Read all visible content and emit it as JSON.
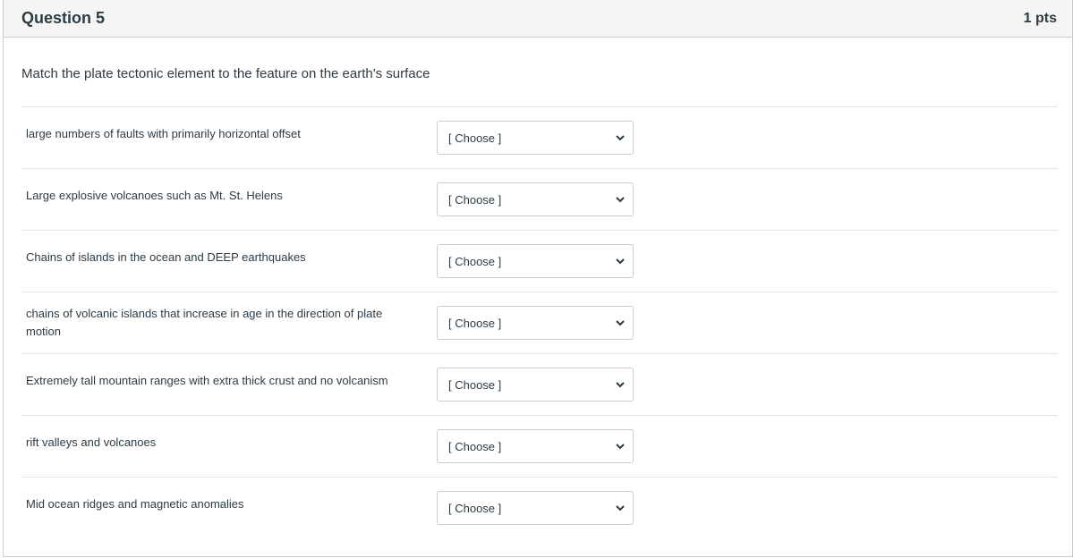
{
  "question": {
    "title": "Question 5",
    "points": "1 pts",
    "prompt": "Match the plate tectonic element to the feature on the earth's surface"
  },
  "rows": [
    {
      "label": "large numbers of faults with primarily horizontal offset",
      "selected": "[ Choose ]"
    },
    {
      "label": "Large explosive volcanoes such as Mt. St. Helens",
      "selected": "[ Choose ]"
    },
    {
      "label": "Chains of islands in the ocean and DEEP earthquakes",
      "selected": "[ Choose ]"
    },
    {
      "label": "chains of volcanic islands that increase in age in the direction of plate motion",
      "selected": "[ Choose ]"
    },
    {
      "label": "Extremely tall mountain ranges with extra thick crust and no volcanism",
      "selected": "[ Choose ]"
    },
    {
      "label": "rift valleys and volcanoes",
      "selected": "[ Choose ]"
    },
    {
      "label": "Mid ocean ridges and magnetic anomalies",
      "selected": "[ Choose ]"
    }
  ],
  "icons": {
    "dropdown": "chevron-down-icon"
  },
  "colors": {
    "text": "#2d3b45",
    "border": "#c7cdd1",
    "header_bg": "#f5f5f5"
  }
}
